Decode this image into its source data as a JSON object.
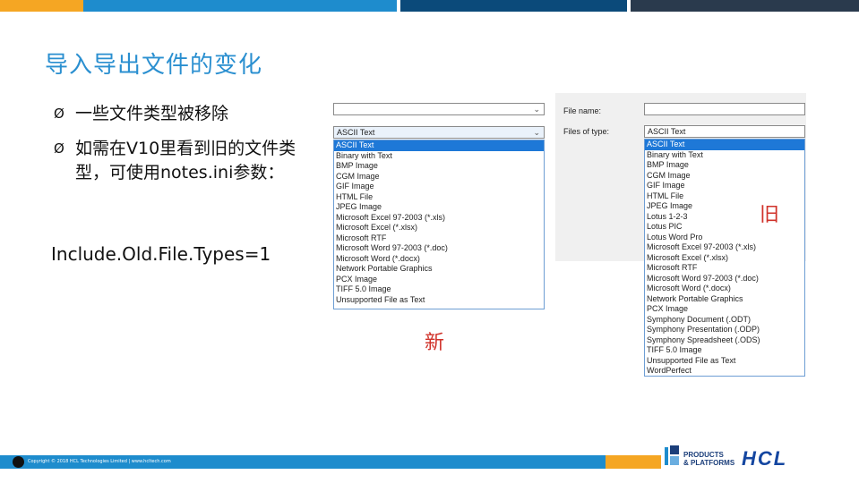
{
  "slide": {
    "title": "导入导出文件的变化",
    "bullets": [
      "一些文件类型被移除",
      "如需在V10里看到旧的文件类型，可使用notes.ini参数："
    ],
    "bullet_marker": "Ø",
    "include_text": "Include.Old.File.Types=1"
  },
  "colors": {
    "title": "#2a8fd0",
    "caption": "#d0322a",
    "selection": "#1e78d7",
    "bar_blue": "#1e8ccd",
    "bar_orange": "#f5a623",
    "bar_dark": "#2a3a4d",
    "bar_navy": "#0b4a7a"
  },
  "new_dialog": {
    "combo_value": "ASCII Text",
    "items": [
      "ASCII Text",
      "Binary with Text",
      "BMP Image",
      "CGM Image",
      "GIF Image",
      "HTML File",
      "JPEG Image",
      "Microsoft Excel 97-2003 (*.xls)",
      "Microsoft Excel (*.xlsx)",
      "Microsoft RTF",
      "Microsoft Word 97-2003 (*.doc)",
      "Microsoft Word (*.docx)",
      "Network Portable Graphics",
      "PCX Image",
      "TIFF 5.0 Image",
      "Unsupported File as Text"
    ],
    "caption": "新"
  },
  "old_dialog": {
    "file_name_label": "File name:",
    "files_of_type_label": "Files of type:",
    "combo_value": "ASCII Text",
    "items": [
      "ASCII Text",
      "Binary with Text",
      "BMP Image",
      "CGM Image",
      "GIF Image",
      "HTML File",
      "JPEG Image",
      "Lotus 1-2-3",
      "Lotus PIC",
      "Lotus Word Pro",
      "Microsoft Excel 97-2003 (*.xls)",
      "Microsoft Excel (*.xlsx)",
      "Microsoft RTF",
      "Microsoft Word 97-2003 (*.doc)",
      "Microsoft Word (*.docx)",
      "Network Portable Graphics",
      "PCX Image",
      "Symphony Document (.ODT)",
      "Symphony Presentation (.ODP)",
      "Symphony Spreadsheet (.ODS)",
      "TIFF 5.0 Image",
      "Unsupported File as Text",
      "WordPerfect"
    ],
    "caption": "旧"
  },
  "footer": {
    "copyright": "Copyright © 2018 HCL Technologies Limited | www.hcltech.com",
    "products_logo_line1": "PRODUCTS",
    "products_logo_line2": "& PLATFORMS",
    "hcl_logo": "HCL"
  }
}
